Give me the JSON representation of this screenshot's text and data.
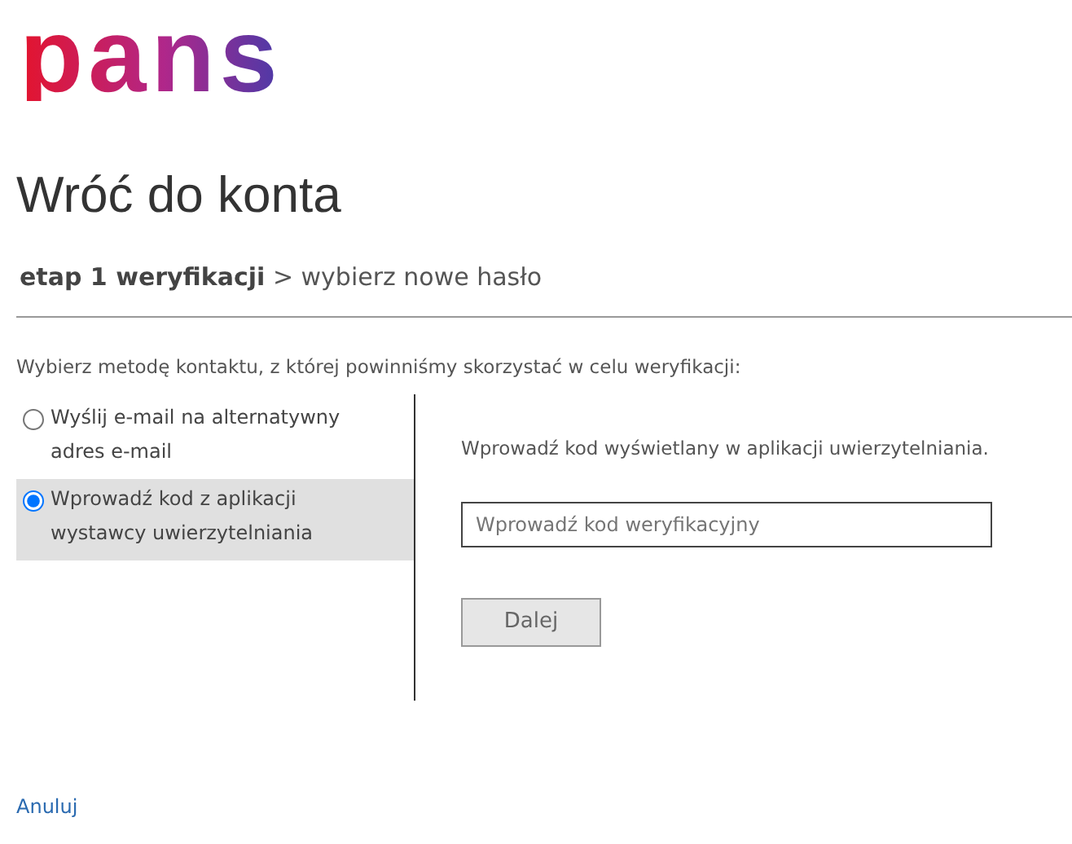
{
  "logo": {
    "text": "pans"
  },
  "title": "Wróć do konta",
  "breadcrumb": {
    "current": "etap 1 weryfikacji",
    "separator": ">",
    "next": "wybierz nowe hasło"
  },
  "instruction": "Wybierz metodę kontaktu, z której powinniśmy skorzystać w celu weryfikacji:",
  "options": [
    {
      "label": "Wyślij e-mail na alternatywny adres e-mail",
      "selected": false
    },
    {
      "label": "Wprowadź kod z aplikacji wystawcy uwierzytelniania",
      "selected": true
    }
  ],
  "detail": {
    "text": "Wprowadź kod wyświetlany w aplikacji uwierzytelniania.",
    "field": {
      "placeholder": "Wprowadź kod weryfikacyjny"
    },
    "button": {
      "label": "Dalej",
      "disabled": true
    }
  },
  "cancel_link": "Anuluj"
}
